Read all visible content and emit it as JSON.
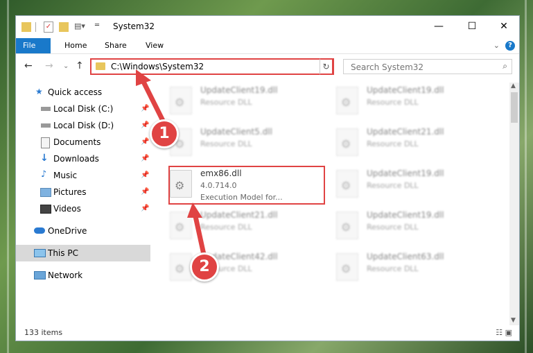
{
  "window": {
    "title": "System32",
    "controls": {
      "minimize": "—",
      "maximize": "☐",
      "close": "✕"
    }
  },
  "ribbon": {
    "tabs": [
      "File",
      "Home",
      "Share",
      "View"
    ],
    "help": "?"
  },
  "navigation": {
    "address_path": "C:\\Windows\\System32",
    "search_placeholder": "Search System32"
  },
  "sidebar": {
    "items": [
      {
        "label": "Quick access",
        "icon": "star-icon"
      },
      {
        "label": "Local Disk (C:)",
        "icon": "drive-icon",
        "pinned": true
      },
      {
        "label": "Local Disk (D:)",
        "icon": "drive-icon",
        "pinned": true
      },
      {
        "label": "Documents",
        "icon": "documents-icon",
        "pinned": true
      },
      {
        "label": "Downloads",
        "icon": "download-icon",
        "pinned": true
      },
      {
        "label": "Music",
        "icon": "music-icon",
        "pinned": true
      },
      {
        "label": "Pictures",
        "icon": "pictures-icon",
        "pinned": true
      },
      {
        "label": "Videos",
        "icon": "videos-icon",
        "pinned": true
      },
      {
        "label": "OneDrive",
        "icon": "cloud-icon"
      },
      {
        "label": "This PC",
        "icon": "computer-icon",
        "selected": true
      },
      {
        "label": "Network",
        "icon": "network-icon"
      }
    ]
  },
  "files": {
    "left_column": [
      {
        "name": "UpdateClient19.dll",
        "type": "Resource DLL"
      },
      {
        "name": "UpdateClient5.dll",
        "type": "Resource DLL"
      },
      {
        "name": "emx86.dll",
        "version": "4.0.714.0",
        "description": "Execution Model for..."
      },
      {
        "name": "UpdateClient21.dll",
        "type": "Resource DLL"
      },
      {
        "name": "UpdateClient42.dll",
        "type": "Resource DLL"
      }
    ],
    "right_column": [
      {
        "name": "UpdateClient19.dll",
        "type": "Resource DLL"
      },
      {
        "name": "UpdateClient21.dll",
        "type": "Resource DLL"
      },
      {
        "name": "UpdateClient19.dll",
        "type": "Resource DLL"
      },
      {
        "name": "UpdateClient19.dll",
        "type": "Resource DLL"
      },
      {
        "name": "UpdateClient63.dll",
        "type": "Resource DLL"
      }
    ]
  },
  "status": {
    "item_count": "133 items"
  },
  "annotations": {
    "step1": "1",
    "step2": "2",
    "color": "#e04343"
  }
}
